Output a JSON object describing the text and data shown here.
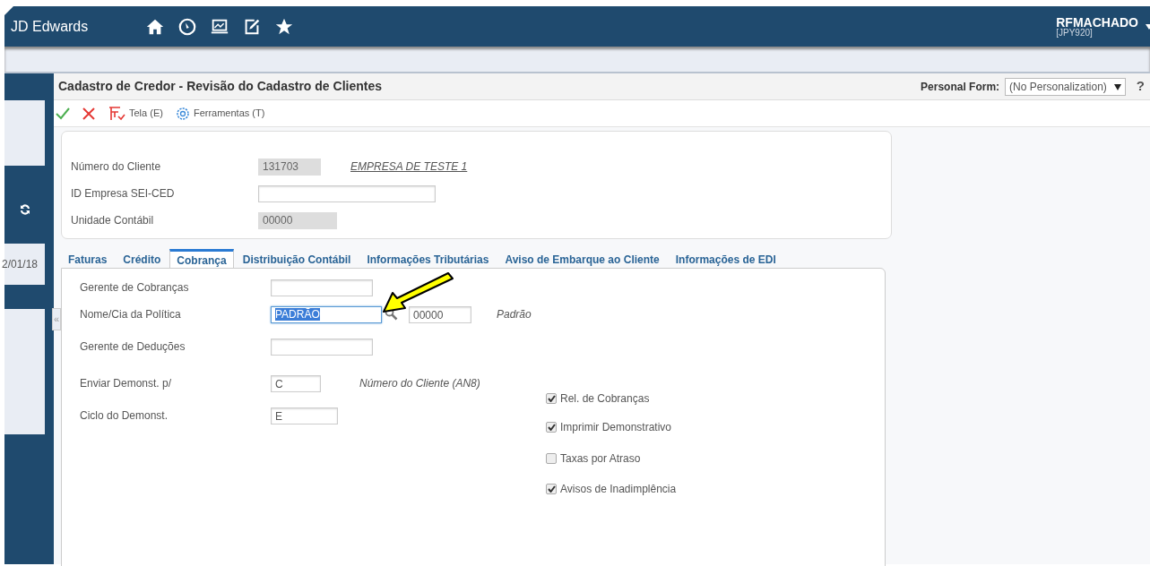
{
  "app": {
    "title": "JD Edwards"
  },
  "user": {
    "name": "RFMACHADO",
    "environment": "[JPY920]"
  },
  "sidebar": {
    "date": "2/01/18",
    "collapse": "«"
  },
  "form": {
    "title": "Cadastro de Credor - Revisão do Cadastro de Clientes",
    "personal_form_label": "Personal Form:",
    "personal_form_value": "(No Personalization)",
    "help": "?"
  },
  "toolbar": [
    {
      "kind": "ok"
    },
    {
      "kind": "cancel"
    },
    {
      "kind": "menu",
      "label": "Tela (E)"
    },
    {
      "kind": "tools",
      "label": "Ferramentas (T)"
    }
  ],
  "header_fields": [
    {
      "label": "Número do Cliente",
      "value": "131703",
      "disabled": true,
      "description": "EMPRESA DE TESTE 1"
    },
    {
      "label": "ID Empresa SEI-CED",
      "disabled": false
    },
    {
      "label": "Unidade Contábil",
      "value": "00000",
      "disabled": true
    }
  ],
  "tabs": [
    {
      "label": "Faturas",
      "selected": false
    },
    {
      "label": "Crédito",
      "selected": false
    },
    {
      "label": "Cobrança",
      "selected": true
    },
    {
      "label": "Distribuição Contábil",
      "selected": false
    },
    {
      "label": "Informações Tributárias",
      "selected": false
    },
    {
      "label": "Aviso de Embarque ao Cliente",
      "selected": false
    },
    {
      "label": "Informações de EDI",
      "selected": false
    }
  ],
  "tab_fields": [
    {
      "label": "Gerente de Cobranças",
      "focused": false
    },
    {
      "label": "Nome/Cia da Política",
      "value": "PADRÃO",
      "focused": true,
      "lookup": true,
      "value_2": "00000",
      "description": "Padrão"
    },
    {
      "label": "Gerente de Deduções",
      "focused": false
    },
    {
      "label": "Enviar Demonst. p/",
      "value": "C",
      "focused": false,
      "description": "Número do Cliente (AN8)"
    },
    {
      "label": "Ciclo do Demonst.",
      "value": "E",
      "focused": false
    }
  ],
  "checkboxes": [
    {
      "label": "Rel. de Cobranças",
      "checked": true
    },
    {
      "label": "Imprimir Demonstrativo",
      "checked": true
    },
    {
      "label": "Taxas por Atraso",
      "checked": false
    },
    {
      "label": "Avisos de Inadimplência",
      "checked": true
    }
  ]
}
